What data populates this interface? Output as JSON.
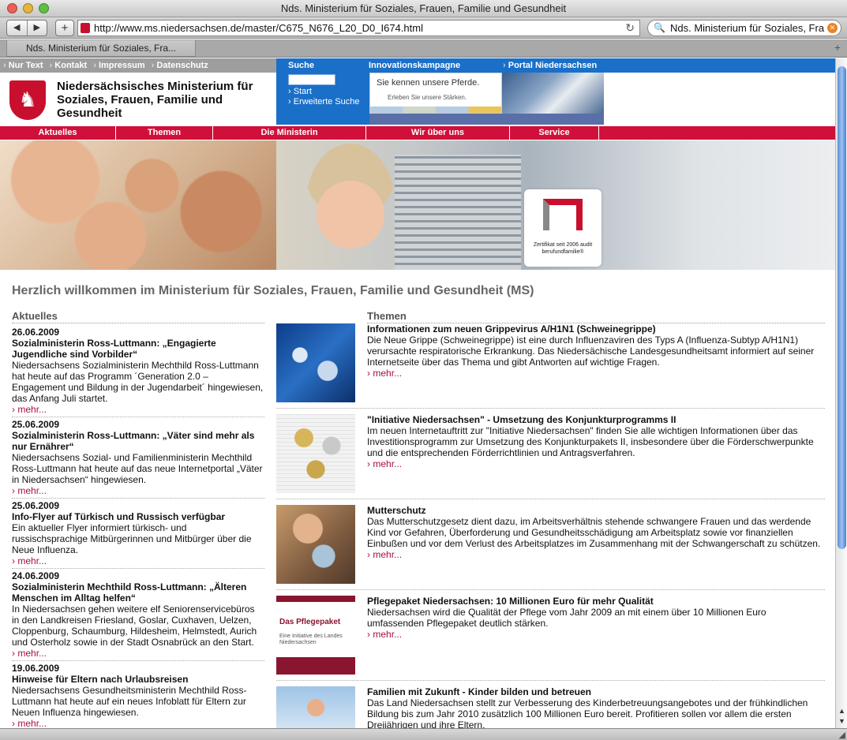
{
  "window": {
    "title": "Nds. Ministerium für Soziales, Frauen, Familie und Gesundheit"
  },
  "toolbar": {
    "url": "http://www.ms.niedersachsen.de/master/C675_N676_L20_D0_I674.html",
    "search_value": "Nds. Ministerium für Soziales, Fra",
    "back_glyph": "◀",
    "forward_glyph": "▶",
    "add_glyph": "+",
    "reload_glyph": "↻",
    "search_glyph": "🔍"
  },
  "tabs": [
    {
      "label": "Nds. Ministerium für Soziales, Fra..."
    }
  ],
  "meta_nav": [
    "Nur Text",
    "Kontakt",
    "Impressum",
    "Datenschutz"
  ],
  "blue_nav": {
    "suche": "Suche",
    "innovation": "Innovationskampagne",
    "portal": "Portal Niedersachsen"
  },
  "search_panel": {
    "start": "Start",
    "advanced": "Erweiterte Suche"
  },
  "banner": {
    "line1": "Sie kennen unsere Pferde.",
    "line2": "Erleben Sie unsere Stärken."
  },
  "ministry": {
    "name": "Niedersächsisches Ministerium für Soziales, Frauen, Familie und Gesundheit"
  },
  "main_nav": [
    "Aktuelles",
    "Themen",
    "Die Ministerin",
    "Wir über uns",
    "Service"
  ],
  "certificate": {
    "text": "Zertifikat seit 2006 audit berufundfamilie®"
  },
  "welcome": "Herzlich willkommen im Ministerium für Soziales, Frauen, Familie und Gesundheit (MS)",
  "news": {
    "heading": "Aktuelles",
    "more": "mehr...",
    "items": [
      {
        "date": "26.06.2009",
        "title": "Sozialministerin Ross-Luttmann: „Engagierte Jugendliche sind Vorbilder“",
        "text": "Niedersachsens Sozialministerin Mechthild Ross-Luttmann hat heute auf das Programm ´Generation 2.0 – Engagement und Bildung in der Jugendarbeit´ hingewiesen, das Anfang Juli startet."
      },
      {
        "date": "25.06.2009",
        "title": "Sozialministerin Ross-Luttmann: „Väter sind mehr als nur Ernährer“",
        "text": "Niedersachsens Sozial- und Familienministerin Mechthild Ross-Luttmann hat heute auf das neue Internetportal „Väter in Niedersachsen“ hingewiesen."
      },
      {
        "date": "25.06.2009",
        "title": "Info-Flyer auf Türkisch und Russisch verfügbar",
        "text": "Ein aktueller Flyer informiert türkisch- und russischsprachige Mitbürgerinnen und Mitbürger über die Neue Influenza."
      },
      {
        "date": "24.06.2009",
        "title": "Sozialministerin Mechthild Ross-Luttmann: „Älteren Menschen im Alltag helfen“",
        "text": "In Niedersachsen gehen weitere elf Seniorenservicebüros in den Landkreisen Friesland, Goslar, Cuxhaven, Uelzen, Cloppenburg, Schaumburg, Hildesheim, Helmstedt, Aurich und Osterholz sowie in der Stadt Osnabrück an den Start."
      },
      {
        "date": "19.06.2009",
        "title": "Hinweise für Eltern nach Urlaubsreisen",
        "text": "Niedersachsens Gesundheitsministerin Mechthild Ross-Luttmann hat heute auf ein neues Infoblatt für Eltern zur Neuen Influenza hingewiesen."
      }
    ]
  },
  "topics": {
    "heading": "Themen",
    "more": "mehr...",
    "pflegepaket_logo": "Das Pflegepaket",
    "pflegepaket_sub": "Eine Initiative des Landes Niedersachsen",
    "items": [
      {
        "title": "Informationen zum neuen Grippevirus A/H1N1 (Schweinegrippe)",
        "text": "Die Neue Grippe (Schweinegrippe) ist eine durch Influenzaviren des Typs A (Influenza-Subtyp A/H1N1) verursachte respiratorische Erkrankung. Das Niedersächische Landesgesundheitsamt informiert auf seiner Internetseite über das Thema und gibt Antworten auf wichtige Fragen."
      },
      {
        "title": "\"Initiative Niedersachsen\" - Umsetzung des Konjunkturprogramms II",
        "text": "Im neuen Internetauftritt zur \"Initiative Niedersachsen\" finden Sie alle wichtigen Informationen über das Investitionsprogramm zur Umsetzung des Konjunkturpakets II, insbesondere über die Förderschwerpunkte und die entsprechenden Förderrichtlinien und Antragsverfahren."
      },
      {
        "title": "Mutterschutz",
        "text": "Das Mutterschutzgesetz dient dazu, im Arbeitsverhältnis stehende schwangere Frauen und das werdende Kind vor Gefahren, Überforderung und Gesundheitsschädigung am Arbeitsplatz sowie vor finanziellen Einbußen und vor dem Verlust des Arbeitsplatzes im Zusammenhang mit der Schwangerschaft zu schützen."
      },
      {
        "title": "Pflegepaket Niedersachsen: 10 Millionen Euro für mehr Qualität",
        "text": "Niedersachsen wird die Qualität der Pflege vom Jahr 2009 an mit einem über 10 Millionen Euro umfassenden Pflegepaket deutlich stärken."
      },
      {
        "title": "Familien mit Zukunft - Kinder bilden und betreuen",
        "text": "Das Land Niedersachsen stellt zur Verbesserung des Kinderbetreuungsangebotes und der frühkindlichen Bildung bis zum Jahr 2010 zusätzlich 100 Millionen Euro bereit. Profitieren sollen vor allem die ersten Dreijährigen und ihre Eltern."
      }
    ]
  },
  "colors": {
    "red": "#d0103a",
    "blue": "#1a6fc8",
    "link": "#a6113a"
  }
}
